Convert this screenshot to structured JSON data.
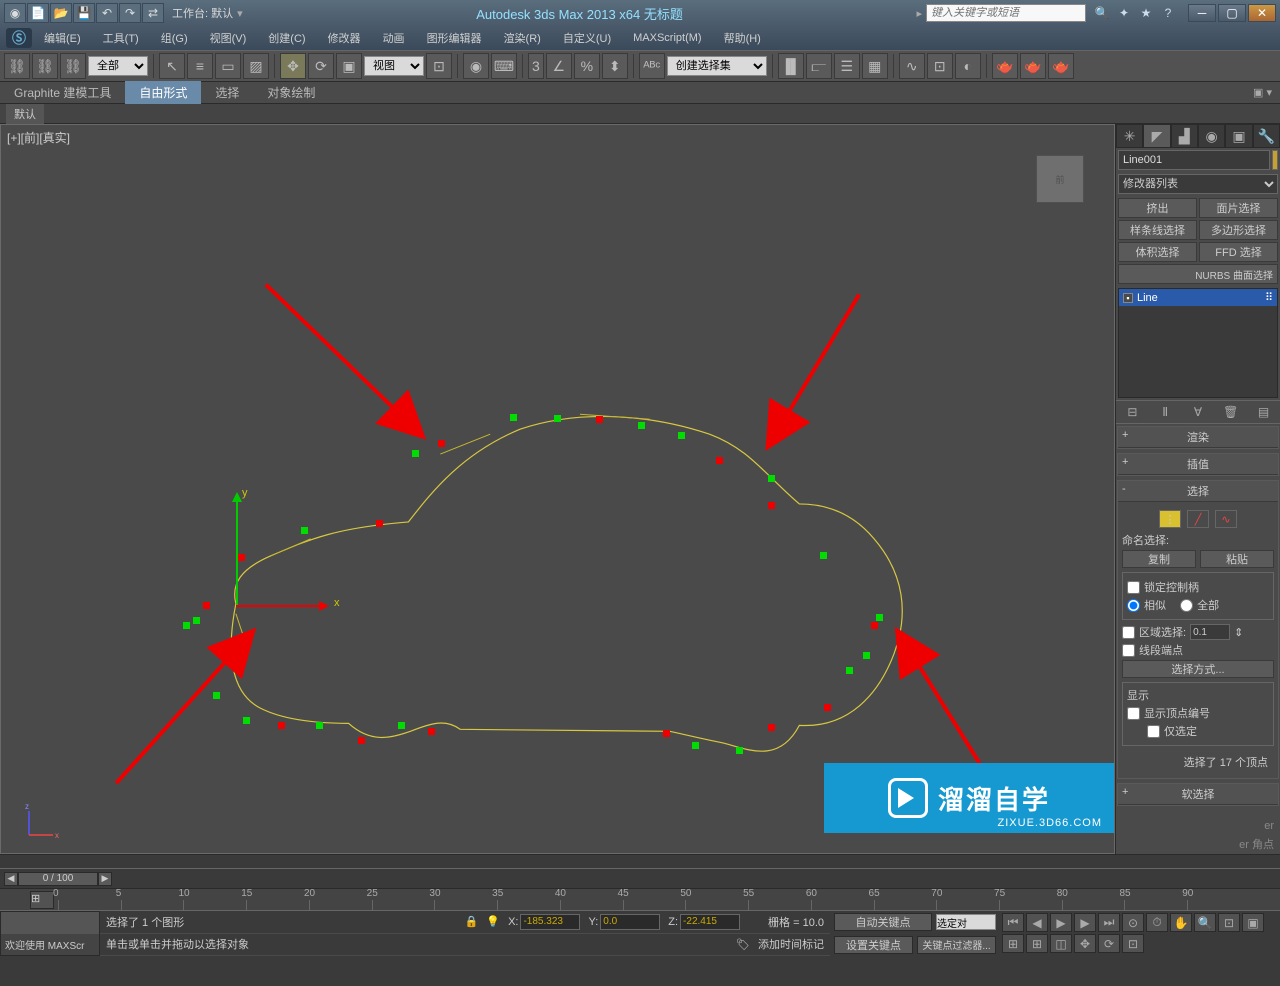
{
  "titlebar": {
    "workspace": "工作台: 默认",
    "title": "Autodesk 3ds Max  2013 x64   无标题",
    "search_placeholder": "键入关键字或短语"
  },
  "menubar": [
    "编辑(E)",
    "工具(T)",
    "组(G)",
    "视图(V)",
    "创建(C)",
    "修改器",
    "动画",
    "图形编辑器",
    "渲染(R)",
    "自定义(U)",
    "MAXScript(M)",
    "帮助(H)"
  ],
  "toolbar": {
    "filter": "全部",
    "view": "视图",
    "selset": "创建选择集"
  },
  "ribbon": {
    "tabs": [
      "Graphite 建模工具",
      "自由形式",
      "选择",
      "对象绘制"
    ],
    "active": 1,
    "sub": "默认"
  },
  "viewport": {
    "label": "[+][前][真实]",
    "axis_y": "y",
    "axis_x": "x"
  },
  "cmdpanel": {
    "obj_name": "Line001",
    "modlist": "修改器列表",
    "modbtns": [
      "挤出",
      "面片选择",
      "样条线选择",
      "多边形选择",
      "体积选择",
      "FFD 选择"
    ],
    "modbtns_wide": "NURBS 曲面选择",
    "stack_item": "Line",
    "rollouts": {
      "render": "渲染",
      "interp": "插值",
      "sel": "选择",
      "soft": "软选择"
    },
    "sel_section": {
      "named_label": "命名选择:",
      "copy": "复制",
      "paste": "粘贴",
      "lock": "锁定控制柄",
      "similar": "相似",
      "all": "全部",
      "region": "区域选择:",
      "region_val": "0.1",
      "segend": "线段端点",
      "selmode": "选择方式...",
      "display": "显示",
      "show_num": "显示顶点编号",
      "only_sel": "仅选定",
      "status": "选择了 17 个顶点"
    },
    "bezhint1": "er",
    "bezhint2": "er 角点"
  },
  "timeslider": {
    "value": "0 / 100"
  },
  "timeruler": [
    0,
    5,
    10,
    15,
    20,
    25,
    30,
    35,
    40,
    45,
    50,
    55,
    60,
    65,
    70,
    75,
    80,
    85,
    90
  ],
  "statusbar": {
    "welcome": "欢迎使用  MAXScr",
    "sel_info": "选择了 1 个图形",
    "hint": "单击或单击并拖动以选择对象",
    "x": "-185.323",
    "y": "0.0",
    "z": "-22.415",
    "grid": "栅格 = 10.0",
    "addmark": "添加时间标记",
    "autokey": "自动关键点",
    "setkey": "设置关键点",
    "keyfilter": "关键点过滤器...",
    "selset2": "选定对"
  },
  "watermark": {
    "text": "溜溜自学",
    "url": "ZIXUE.3D66.COM"
  }
}
